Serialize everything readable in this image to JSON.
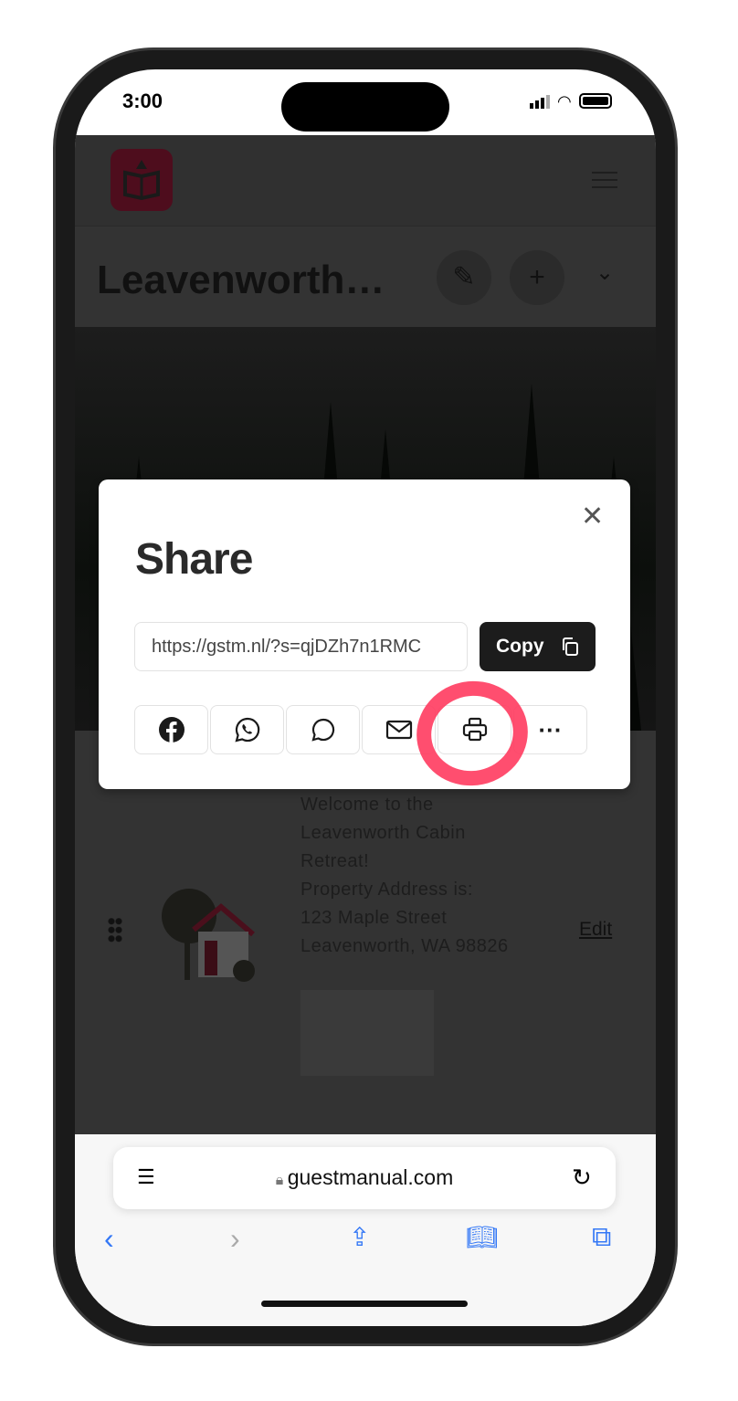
{
  "status_bar": {
    "time": "3:00"
  },
  "page": {
    "title": "Leavenworth…",
    "content_text": [
      "Welcome to the",
      "Leavenworth Cabin",
      "Retreat!",
      "Property Address is:",
      "123 Maple Street",
      "Leavenworth, WA 98826"
    ],
    "edit_label": "Edit"
  },
  "share_modal": {
    "title": "Share",
    "url_value": "https://gstm.nl/?s=qjDZh7n1RMC",
    "copy_label": "Copy",
    "buttons": [
      "facebook-icon",
      "whatsapp-icon",
      "message-icon",
      "email-icon",
      "print-icon",
      "more-icon"
    ],
    "highlight_color": "#ff3b5f"
  },
  "browser": {
    "domain": "guestmanual.com"
  },
  "colors": {
    "brand": "#8a1538",
    "safari_blue": "#3478f6"
  }
}
